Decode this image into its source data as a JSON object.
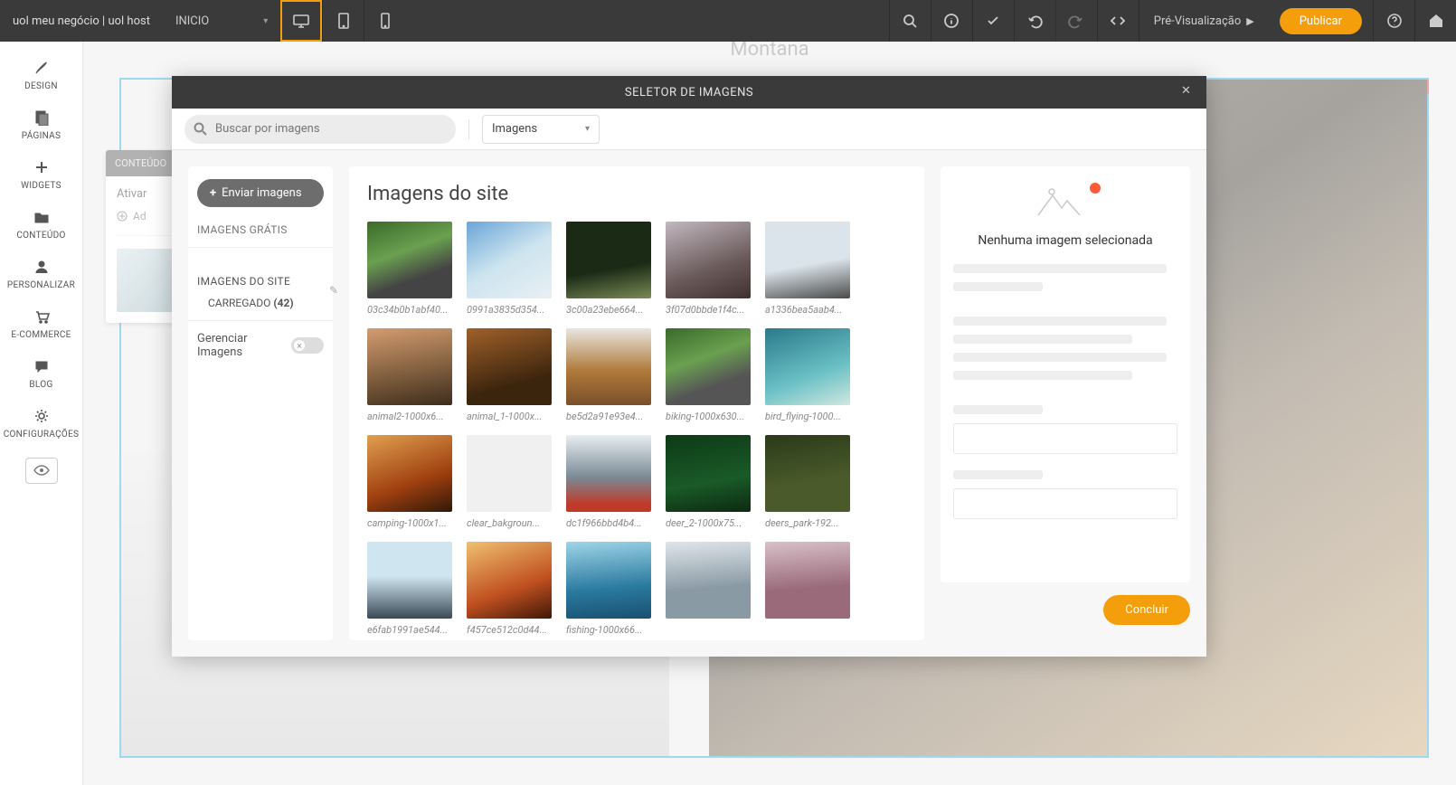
{
  "topbar": {
    "brand": "uol meu negócio | uol host",
    "page_selector_label": "INICIO",
    "preview_label": "Pré-Visualização",
    "publish_label": "Publicar"
  },
  "sidebar": {
    "items": [
      {
        "label": "DESIGN"
      },
      {
        "label": "PÁGINAS"
      },
      {
        "label": "WIDGETS"
      },
      {
        "label": "CONTEÚDO"
      },
      {
        "label": "PERSONALIZAR"
      },
      {
        "label": "E-COMMERCE"
      },
      {
        "label": "BLOG"
      },
      {
        "label": "CONFIGURAÇÕES"
      }
    ]
  },
  "flyout": {
    "tab": "CONTEÚDO",
    "activate": "Ativar",
    "add": "Ad"
  },
  "bg_text": "Montana",
  "modal": {
    "title": "SELETOR DE IMAGENS",
    "search_placeholder": "Buscar por imagens",
    "type_label": "Imagens",
    "left": {
      "upload_label": "Enviar imagens",
      "free_images": "IMAGENS GRÁTIS",
      "site_images": "IMAGENS DO SITE",
      "uploaded_label": "CARREGADO",
      "uploaded_count": "(42)",
      "manage_label": "Gerenciar Imagens"
    },
    "center": {
      "title": "Imagens do site",
      "images": [
        {
          "label": "03c34b0b1abf40...",
          "bg": "linear-gradient(160deg,#3a6a2a,#6aa050 40%,#444 70%)"
        },
        {
          "label": "0991a3835d354...",
          "bg": "linear-gradient(150deg,#6aa5d8,#cde4ef 50%,#e8f0f4)"
        },
        {
          "label": "3c00a23ebe664...",
          "bg": "linear-gradient(170deg,#1a2a15 60%,#7a8a55)"
        },
        {
          "label": "3f07d0bbde1f4c...",
          "bg": "linear-gradient(160deg,#c2b8c0,#6a5a5a 60%,#403030)"
        },
        {
          "label": "a1336bea5aab4...",
          "bg": "linear-gradient(170deg,#dbe4ea 55%,#4a4a4a)"
        },
        {
          "label": "animal2-1000x6...",
          "bg": "linear-gradient(170deg,#d49c70,#7a5a3b 60%,#3d2d1d)"
        },
        {
          "label": "animal_1-1000x...",
          "bg": "linear-gradient(165deg,#a0602a,#3c250d 70%)"
        },
        {
          "label": "be5d2a91e93e4...",
          "bg": "linear-gradient(180deg,#e8e6e0,#b07a3a 55%,#7a502a)"
        },
        {
          "label": "biking-1000x630...",
          "bg": "linear-gradient(160deg,#3a6a2a,#6aa050 40%,#555 70%)"
        },
        {
          "label": "bird_flying-1000...",
          "bg": "linear-gradient(160deg,#2a7a8a,#6ac0c5 60%,#d0e8e0)"
        },
        {
          "label": "camping-1000x1...",
          "bg": "linear-gradient(160deg,#e0a050,#a04010 60%,#301808)"
        },
        {
          "label": "clear_bakgroun...",
          "bg": "#f0f0f0"
        },
        {
          "label": "dc1f966bbd4b4...",
          "bg": "linear-gradient(180deg,#e8eef2,#7a8a95 55%,#c03a2a 90%)"
        },
        {
          "label": "deer_2-1000x75...",
          "bg": "linear-gradient(170deg,#0d3a15,#1a5a28 60%,#0c2a10)"
        },
        {
          "label": "deers_park-192...",
          "bg": "linear-gradient(170deg,#2a3a1a,#4a5a2a 60%)"
        },
        {
          "label": "e6fab1991ae544...",
          "bg": "linear-gradient(180deg,#cfe5f0 45%,#3a4a55)"
        },
        {
          "label": "f457ce512c0d44...",
          "bg": "linear-gradient(160deg,#f0c070,#c05020 60%,#401808)"
        },
        {
          "label": "fishing-1000x66...",
          "bg": "linear-gradient(175deg,#9fd5e8,#2a7aa0 60%,#1a5070)"
        },
        {
          "label": "",
          "bg": "linear-gradient(175deg,#e0e6ea,#8a9aa5 60%)"
        },
        {
          "label": "",
          "bg": "linear-gradient(175deg,#d8c0c8,#9a6a7a 60%)"
        },
        {
          "label": "",
          "bg": "linear-gradient(180deg,#e6e4e0,#b0824a 55%,#7a5530)"
        },
        {
          "label": "",
          "bg": "linear-gradient(180deg,#e0dad4,#a08070 60%,#503828)"
        },
        {
          "label": "",
          "bg": "linear-gradient(135deg,#d5d0c8,#b0a898 50%,#968c7a)"
        },
        {
          "label": "",
          "bg": "linear-gradient(175deg,#2a4a1a,#1a3010 60%)"
        }
      ]
    },
    "right": {
      "empty_text": "Nenhuma imagem selecionada"
    },
    "finish_label": "Concluir"
  }
}
